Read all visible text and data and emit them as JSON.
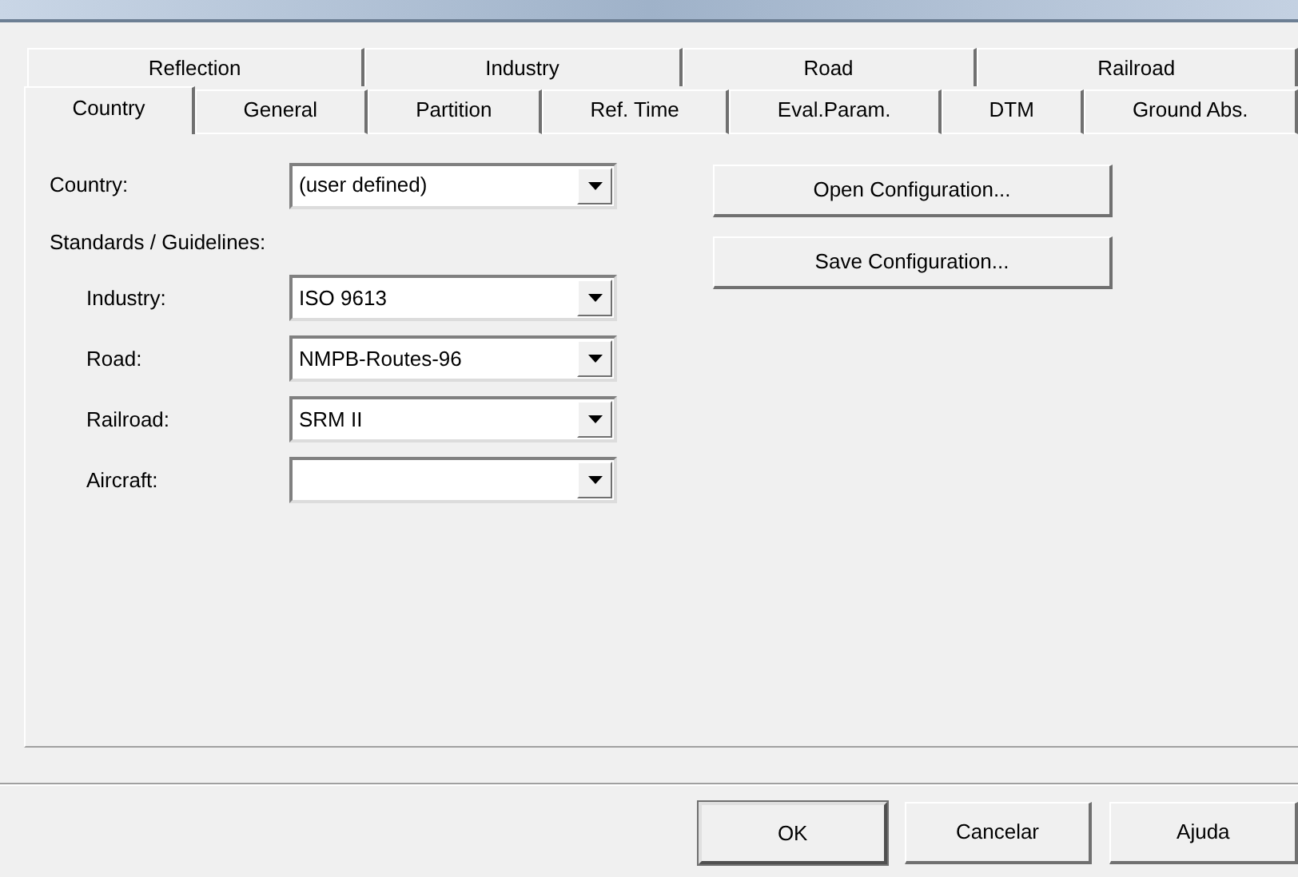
{
  "tab_rows": [
    [
      {
        "label": "Reflection",
        "selected": false
      },
      {
        "label": "Industry",
        "selected": false
      },
      {
        "label": "Road",
        "selected": false
      },
      {
        "label": "Railroad",
        "selected": false
      }
    ],
    [
      {
        "label": "Country",
        "selected": true
      },
      {
        "label": "General",
        "selected": false
      },
      {
        "label": "Partition",
        "selected": false
      },
      {
        "label": "Ref. Time",
        "selected": false
      },
      {
        "label": "Eval.Param.",
        "selected": false
      },
      {
        "label": "DTM",
        "selected": false
      },
      {
        "label": "Ground Abs.",
        "selected": false
      }
    ]
  ],
  "country": {
    "label": "Country:",
    "value": "(user defined)"
  },
  "standards": {
    "label": "Standards / Guidelines:",
    "fields": [
      {
        "label": "Industry:",
        "value": "ISO 9613"
      },
      {
        "label": "Road:",
        "value": "NMPB-Routes-96"
      },
      {
        "label": "Railroad:",
        "value": "SRM II"
      },
      {
        "label": "Aircraft:"
      }
    ]
  },
  "config_buttons": [
    "Open Configuration...",
    "Save Configuration..."
  ],
  "dialog_buttons": [
    {
      "label": "OK",
      "default": true
    },
    {
      "label": "Cancelar",
      "default": false
    },
    {
      "label": "Ajuda",
      "default": false
    }
  ]
}
